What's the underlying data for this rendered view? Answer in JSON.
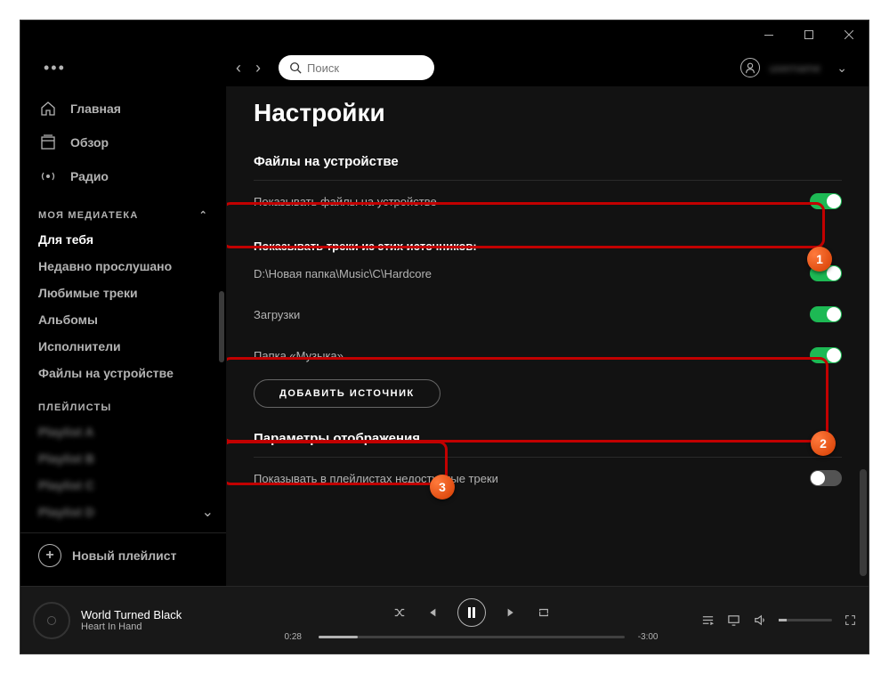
{
  "window": {
    "minimize": "—",
    "maximize": "☐",
    "close": "✕"
  },
  "topbar": {
    "search_placeholder": "Поиск",
    "user_name": "username"
  },
  "sidebar": {
    "main": [
      {
        "label": "Главная",
        "icon": "home"
      },
      {
        "label": "Обзор",
        "icon": "browse"
      },
      {
        "label": "Радио",
        "icon": "radio"
      }
    ],
    "library_header": "МОЯ МЕДИАТЕКА",
    "library": [
      {
        "label": "Для тебя"
      },
      {
        "label": "Недавно прослушано"
      },
      {
        "label": "Любимые треки"
      },
      {
        "label": "Альбомы"
      },
      {
        "label": "Исполнители"
      },
      {
        "label": "Файлы на устройстве"
      }
    ],
    "playlists_header": "ПЛЕЙЛИСТЫ",
    "playlists_hidden": [
      "Playlist A",
      "Playlist B",
      "Playlist C",
      "Playlist D"
    ],
    "new_playlist": "Новый плейлист"
  },
  "settings": {
    "title": "Настройки",
    "local_files_header": "Файлы на устройстве",
    "show_local_files": {
      "label": "Показывать файлы на устройстве",
      "on": true
    },
    "sources_label": "Показывать треки из этих источников:",
    "sources": [
      {
        "label": "D:\\Новая папка\\Music\\C\\Hardcore",
        "on": true
      },
      {
        "label": "Загрузки",
        "on": true
      },
      {
        "label": "Папка «Музыка»",
        "on": true
      }
    ],
    "add_source": "ДОБАВИТЬ ИСТОЧНИК",
    "display_header": "Параметры отображения",
    "show_unavailable": {
      "label": "Показывать в плейлистах недоступные треки",
      "on": false
    }
  },
  "player": {
    "track": "World Turned Black",
    "artist": "Heart In Hand",
    "elapsed": "0:28",
    "remaining": "-3:00"
  },
  "annotations": {
    "b1": "1",
    "b2": "2",
    "b3": "3"
  }
}
